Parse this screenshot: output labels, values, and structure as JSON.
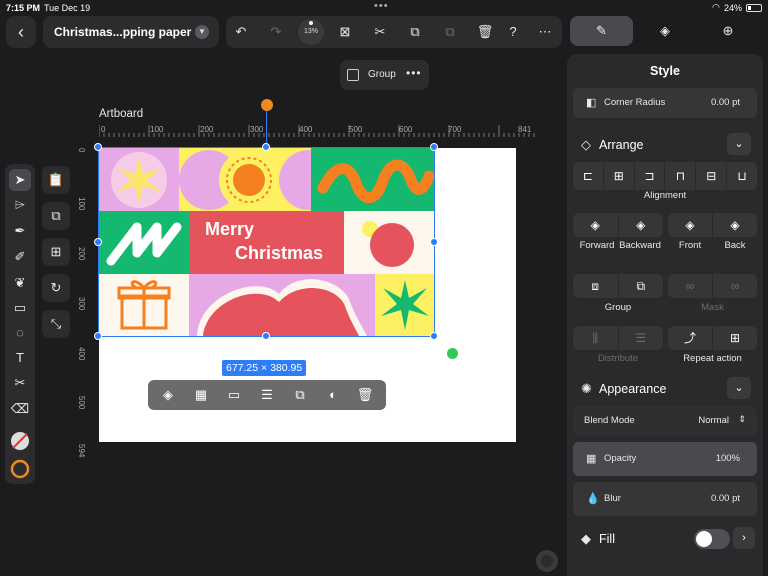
{
  "status": {
    "time": "7:15 PM",
    "date": "Tue Dec 19",
    "battery": "24%"
  },
  "document": {
    "title": "Christmas...pping paper"
  },
  "toolbar": {
    "zoom": "13%"
  },
  "selection_chip": {
    "label": "Group"
  },
  "artboard": {
    "label": "Artboard",
    "ruler_h": [
      "0",
      "100",
      "200",
      "300",
      "400",
      "500",
      "600",
      "700",
      "841"
    ],
    "ruler_v": [
      "0",
      "100",
      "200",
      "300",
      "400",
      "500",
      "594"
    ],
    "design": {
      "line1": "Merry",
      "line2": "Christmas"
    },
    "dimensions": "677.25 × 380.95"
  },
  "panel": {
    "title": "Style",
    "corner_radius": {
      "label": "Corner Radius",
      "value": "0.00 pt"
    },
    "arrange": {
      "title": "Arrange",
      "alignment_label": "Alignment",
      "forward": "Forward",
      "backward": "Backward",
      "front": "Front",
      "back": "Back",
      "group": "Group",
      "mask": "Mask",
      "distribute": "Distribute",
      "repeat_action": "Repeat action"
    },
    "appearance": {
      "title": "Appearance",
      "blend_mode": {
        "label": "Blend Mode",
        "value": "Normal"
      },
      "opacity": {
        "label": "Opacity",
        "value": "100%"
      },
      "blur": {
        "label": "Blur",
        "value": "0.00 pt"
      }
    },
    "fill": {
      "title": "Fill",
      "enabled": false
    }
  },
  "colors": {
    "accent": "#2f7df6",
    "stroke": "#f08a1c",
    "panel": "#2a2a2c"
  }
}
